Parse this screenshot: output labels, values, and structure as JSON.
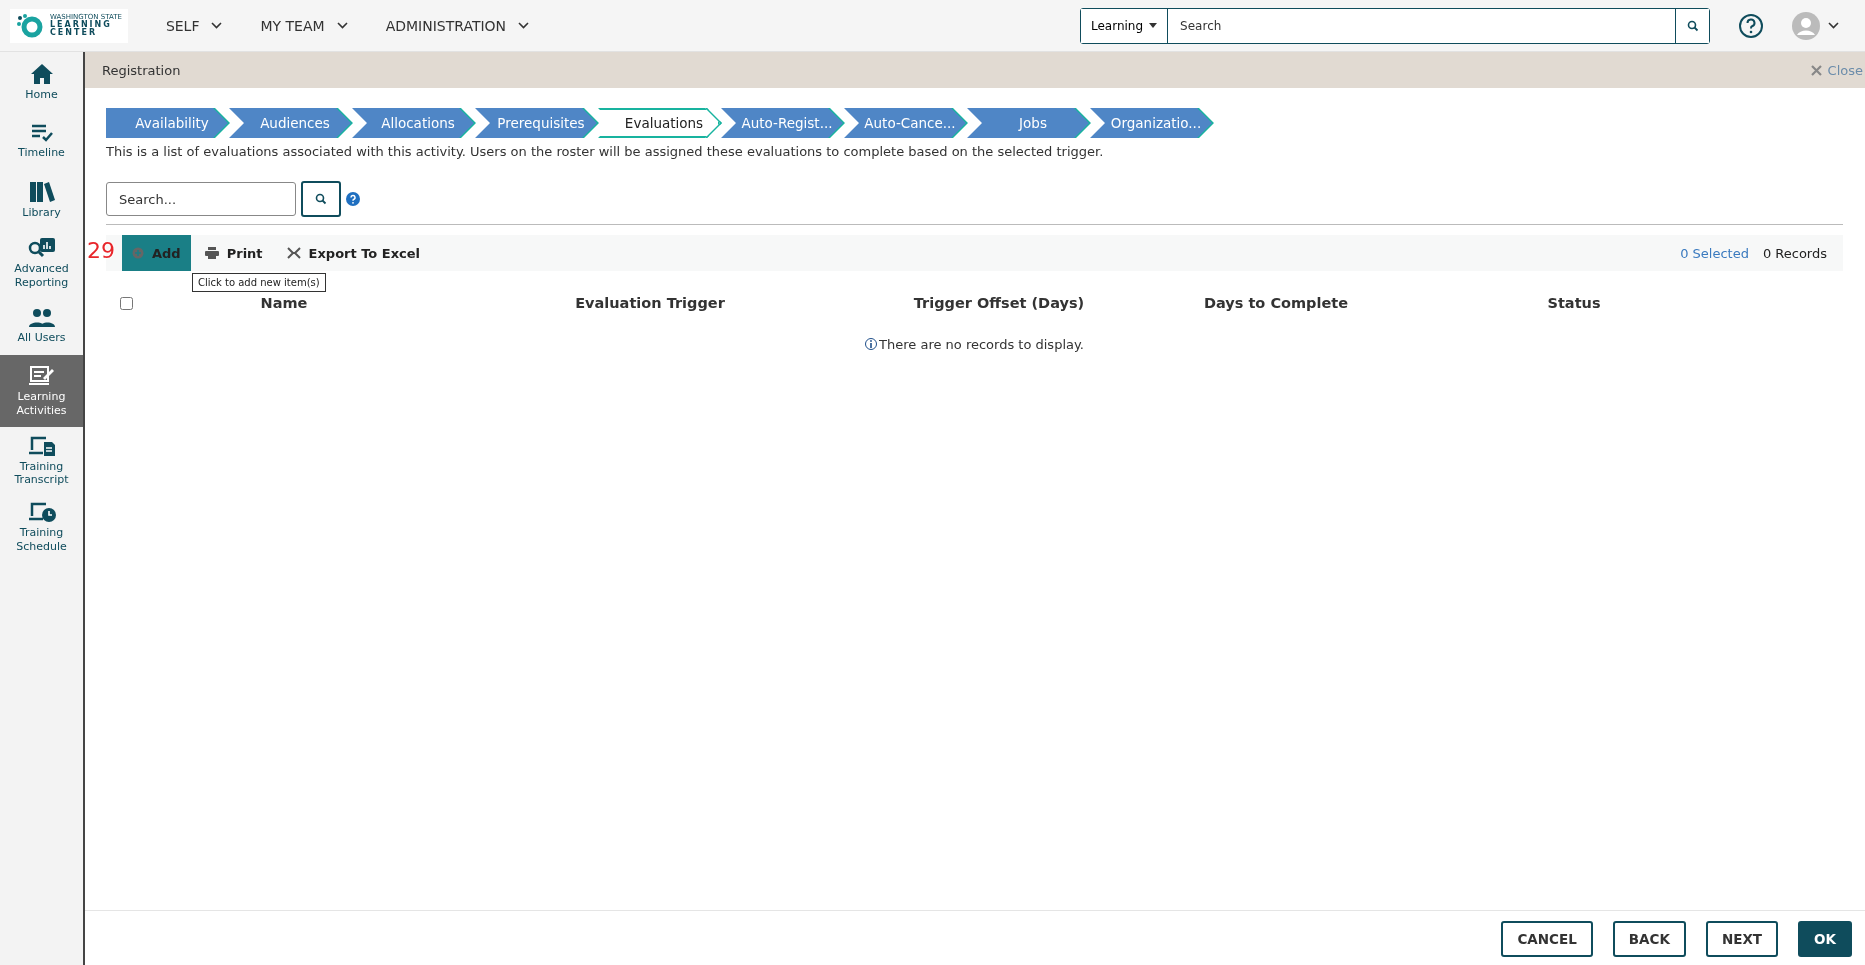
{
  "logo": {
    "lines": [
      "WASHINGTON STATE",
      "LEARNING",
      "CENTER"
    ]
  },
  "top_nav": [
    {
      "label": "SELF"
    },
    {
      "label": "MY TEAM"
    },
    {
      "label": "ADMINISTRATION"
    }
  ],
  "search": {
    "scope": "Learning",
    "placeholder": "Search"
  },
  "sidebar": {
    "items": [
      {
        "label": "Home",
        "selected": false
      },
      {
        "label": "Timeline",
        "selected": false
      },
      {
        "label": "Library",
        "selected": false
      },
      {
        "label": "Advanced Reporting",
        "selected": false
      },
      {
        "label": "All Users",
        "selected": false
      },
      {
        "label": "Learning Activities",
        "selected": true
      },
      {
        "label": "Training Transcript",
        "selected": false
      },
      {
        "label": "Training Schedule",
        "selected": false
      }
    ]
  },
  "panel": {
    "title": "Registration",
    "close": "Close"
  },
  "steps": [
    {
      "label": "Availability",
      "selected": false
    },
    {
      "label": "Audiences",
      "selected": false
    },
    {
      "label": "Allocations",
      "selected": false
    },
    {
      "label": "Prerequisites",
      "selected": false
    },
    {
      "label": "Evaluations",
      "selected": true
    },
    {
      "label": "Auto-Regist...",
      "selected": false
    },
    {
      "label": "Auto-Cance...",
      "selected": false
    },
    {
      "label": "Jobs",
      "selected": false
    },
    {
      "label": "Organizatio...",
      "selected": false
    }
  ],
  "description": "This is a list of evaluations associated with this activity. Users on the roster will be assigned these evaluations to complete based on the selected trigger.",
  "grid_search": {
    "placeholder": "Search..."
  },
  "toolbar": {
    "annotation": "29",
    "actions": [
      {
        "label": "Add",
        "kind": "add"
      },
      {
        "label": "Print",
        "kind": "print"
      },
      {
        "label": "Export To Excel",
        "kind": "excel"
      }
    ],
    "tooltip": "Click to add new item(s)",
    "selected_count": "0 Selected",
    "records": "0 Records"
  },
  "table": {
    "select_all_checked": false,
    "columns": [
      "Name",
      "Evaluation Trigger",
      "Trigger Offset (Days)",
      "Days to Complete",
      "Status"
    ],
    "empty_message": "There are no records to display."
  },
  "footer_buttons": [
    {
      "label": "CANCEL",
      "primary": false
    },
    {
      "label": "BACK",
      "primary": false
    },
    {
      "label": "NEXT",
      "primary": false
    },
    {
      "label": "OK",
      "primary": true
    }
  ]
}
